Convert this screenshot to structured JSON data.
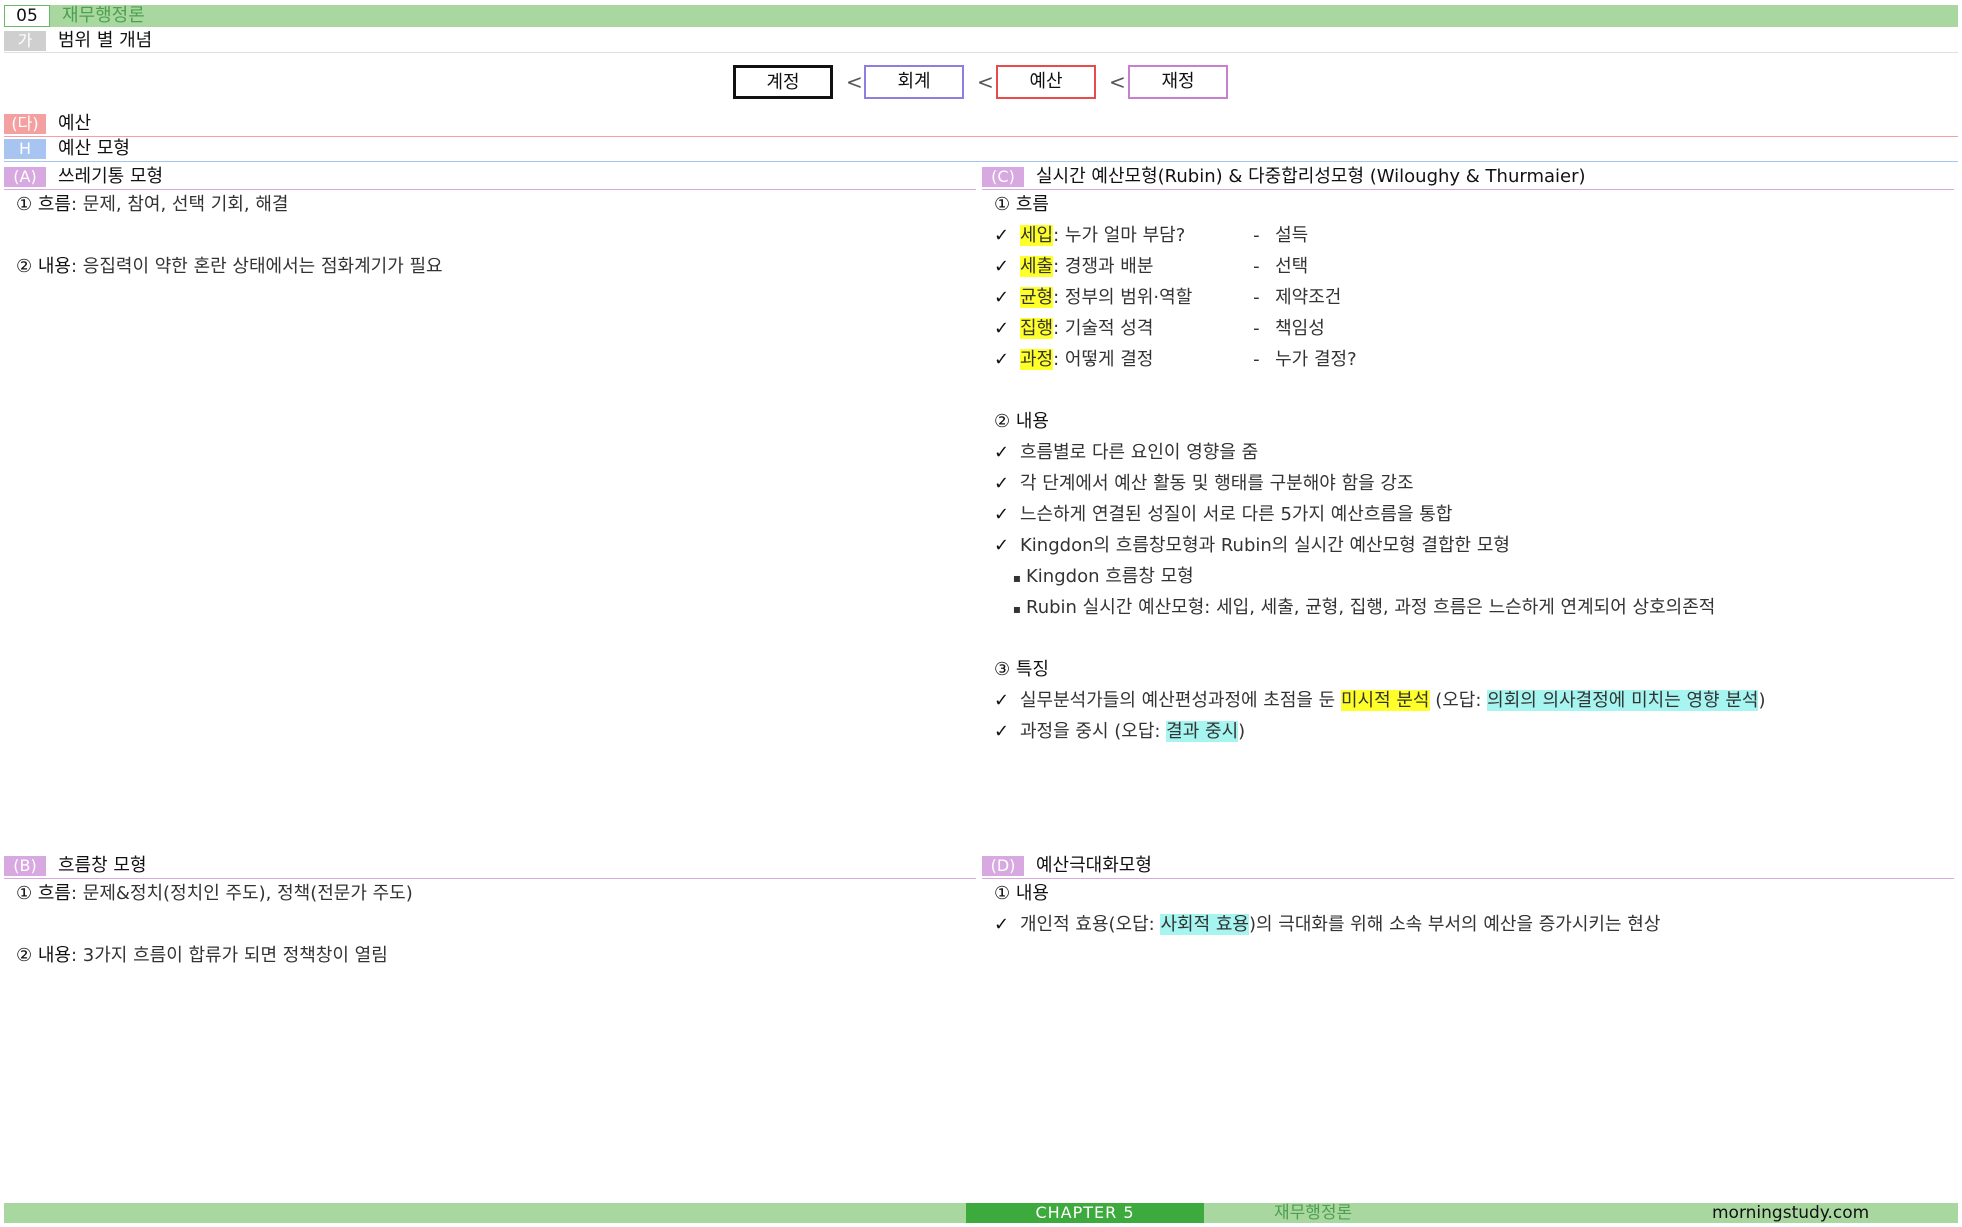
{
  "header": {
    "chapter_no": "05",
    "chapter_title": "재무행정론",
    "sub_tag": "가",
    "sub_title": "범위 별 개념"
  },
  "chain": {
    "items": [
      "계정",
      "회계",
      "예산",
      "재정"
    ],
    "separator": "<",
    "colors": [
      "#111111",
      "#8c7fe0",
      "#e84b4b",
      "#c87fd0"
    ]
  },
  "section_da": {
    "tag": "(다)",
    "title": "예산",
    "color": "#f4a0a0"
  },
  "section_h": {
    "tag": "H",
    "title": "예산 모형",
    "color": "#a8c4f0"
  },
  "panel_a": {
    "tag": "(A)",
    "title": "쓰레기통 모형",
    "color": "#d8a8e0",
    "items": [
      {
        "num": "①",
        "label": "흐름",
        "text": ": 문제, 참여, 선택 기회, 해결"
      },
      {
        "num": "②",
        "label": "내용",
        "text": ": 응집력이 약한 혼란 상태에서는 점화계기가 필요"
      }
    ]
  },
  "panel_b": {
    "tag": "(B)",
    "title": "흐름창 모형",
    "color": "#d8a8e0",
    "items": [
      {
        "num": "①",
        "label": "흐름",
        "text": ": 문제&정치(정치인 주도), 정책(전문가 주도)"
      },
      {
        "num": "②",
        "label": "내용",
        "text": ": 3가지 흐름이 합류가 되면 정책창이 열림"
      }
    ]
  },
  "panel_c": {
    "tag": "(C)",
    "title": "실시간 예산모형(Rubin) & 다중합리성모형 (Wiloughy & Thurmaier)",
    "color": "#d8a8e0",
    "flow_heading": "① 흐름",
    "check": "✓",
    "flows": [
      {
        "key": "세입",
        "desc": ": 누가 얼마 부담?",
        "dash": "-",
        "result": "설득"
      },
      {
        "key": "세출",
        "desc": ": 경쟁과 배분",
        "dash": "-",
        "result": "선택"
      },
      {
        "key": "균형",
        "desc": ": 정부의 범위·역할",
        "dash": "-",
        "result": "제약조건"
      },
      {
        "key": "집행",
        "desc": ": 기술적 성격",
        "dash": "-",
        "result": "책임성"
      },
      {
        "key": "과정",
        "desc": ": 어떻게 결정",
        "dash": "-",
        "result": "누가 결정?"
      }
    ],
    "content_heading": "② 내용",
    "contents": [
      "흐름별로 다른 요인이 영향을 줌",
      "각 단계에서 예산 활동 및 행태를 구분해야 함을 강조",
      "느슨하게 연결된 성질이 서로 다른 5가지 예산흐름을 통합",
      "Kingdon의 흐름창모형과 Rubin의 실시간 예산모형 결합한 모형"
    ],
    "bullet": "▪",
    "bullets": [
      "Kingdon 흐름창 모형",
      "Rubin 실시간 예산모형: 세입, 세출, 균형, 집행, 과정 흐름은 느슨하게 연계되어 상호의존적"
    ],
    "feature_heading": "③ 특징",
    "feature1": {
      "pre": "실무분석가들의 예산편성과정에 초점을 둔 ",
      "hl": "미시적 분석",
      "mid": " (오답: ",
      "hl2": "의회의 의사결정에 미치는 영향 분석",
      "post": ")"
    },
    "feature2": {
      "pre": "과정을 중시 (오답: ",
      "hl2": "결과 중시",
      "post": ")"
    }
  },
  "panel_d": {
    "tag": "(D)",
    "title": "예산극대화모형",
    "color": "#d8a8e0",
    "heading": "① 내용",
    "line": {
      "pre": "개인적 효용(오답: ",
      "hl": "사회적 효용",
      "post": ")의 극대화를 위해 소속 부서의 예산을 증가시키는 현상"
    }
  },
  "footer": {
    "chapter": "CHAPTER 5",
    "title": "재무행정론",
    "site": "morningstudy.com"
  }
}
